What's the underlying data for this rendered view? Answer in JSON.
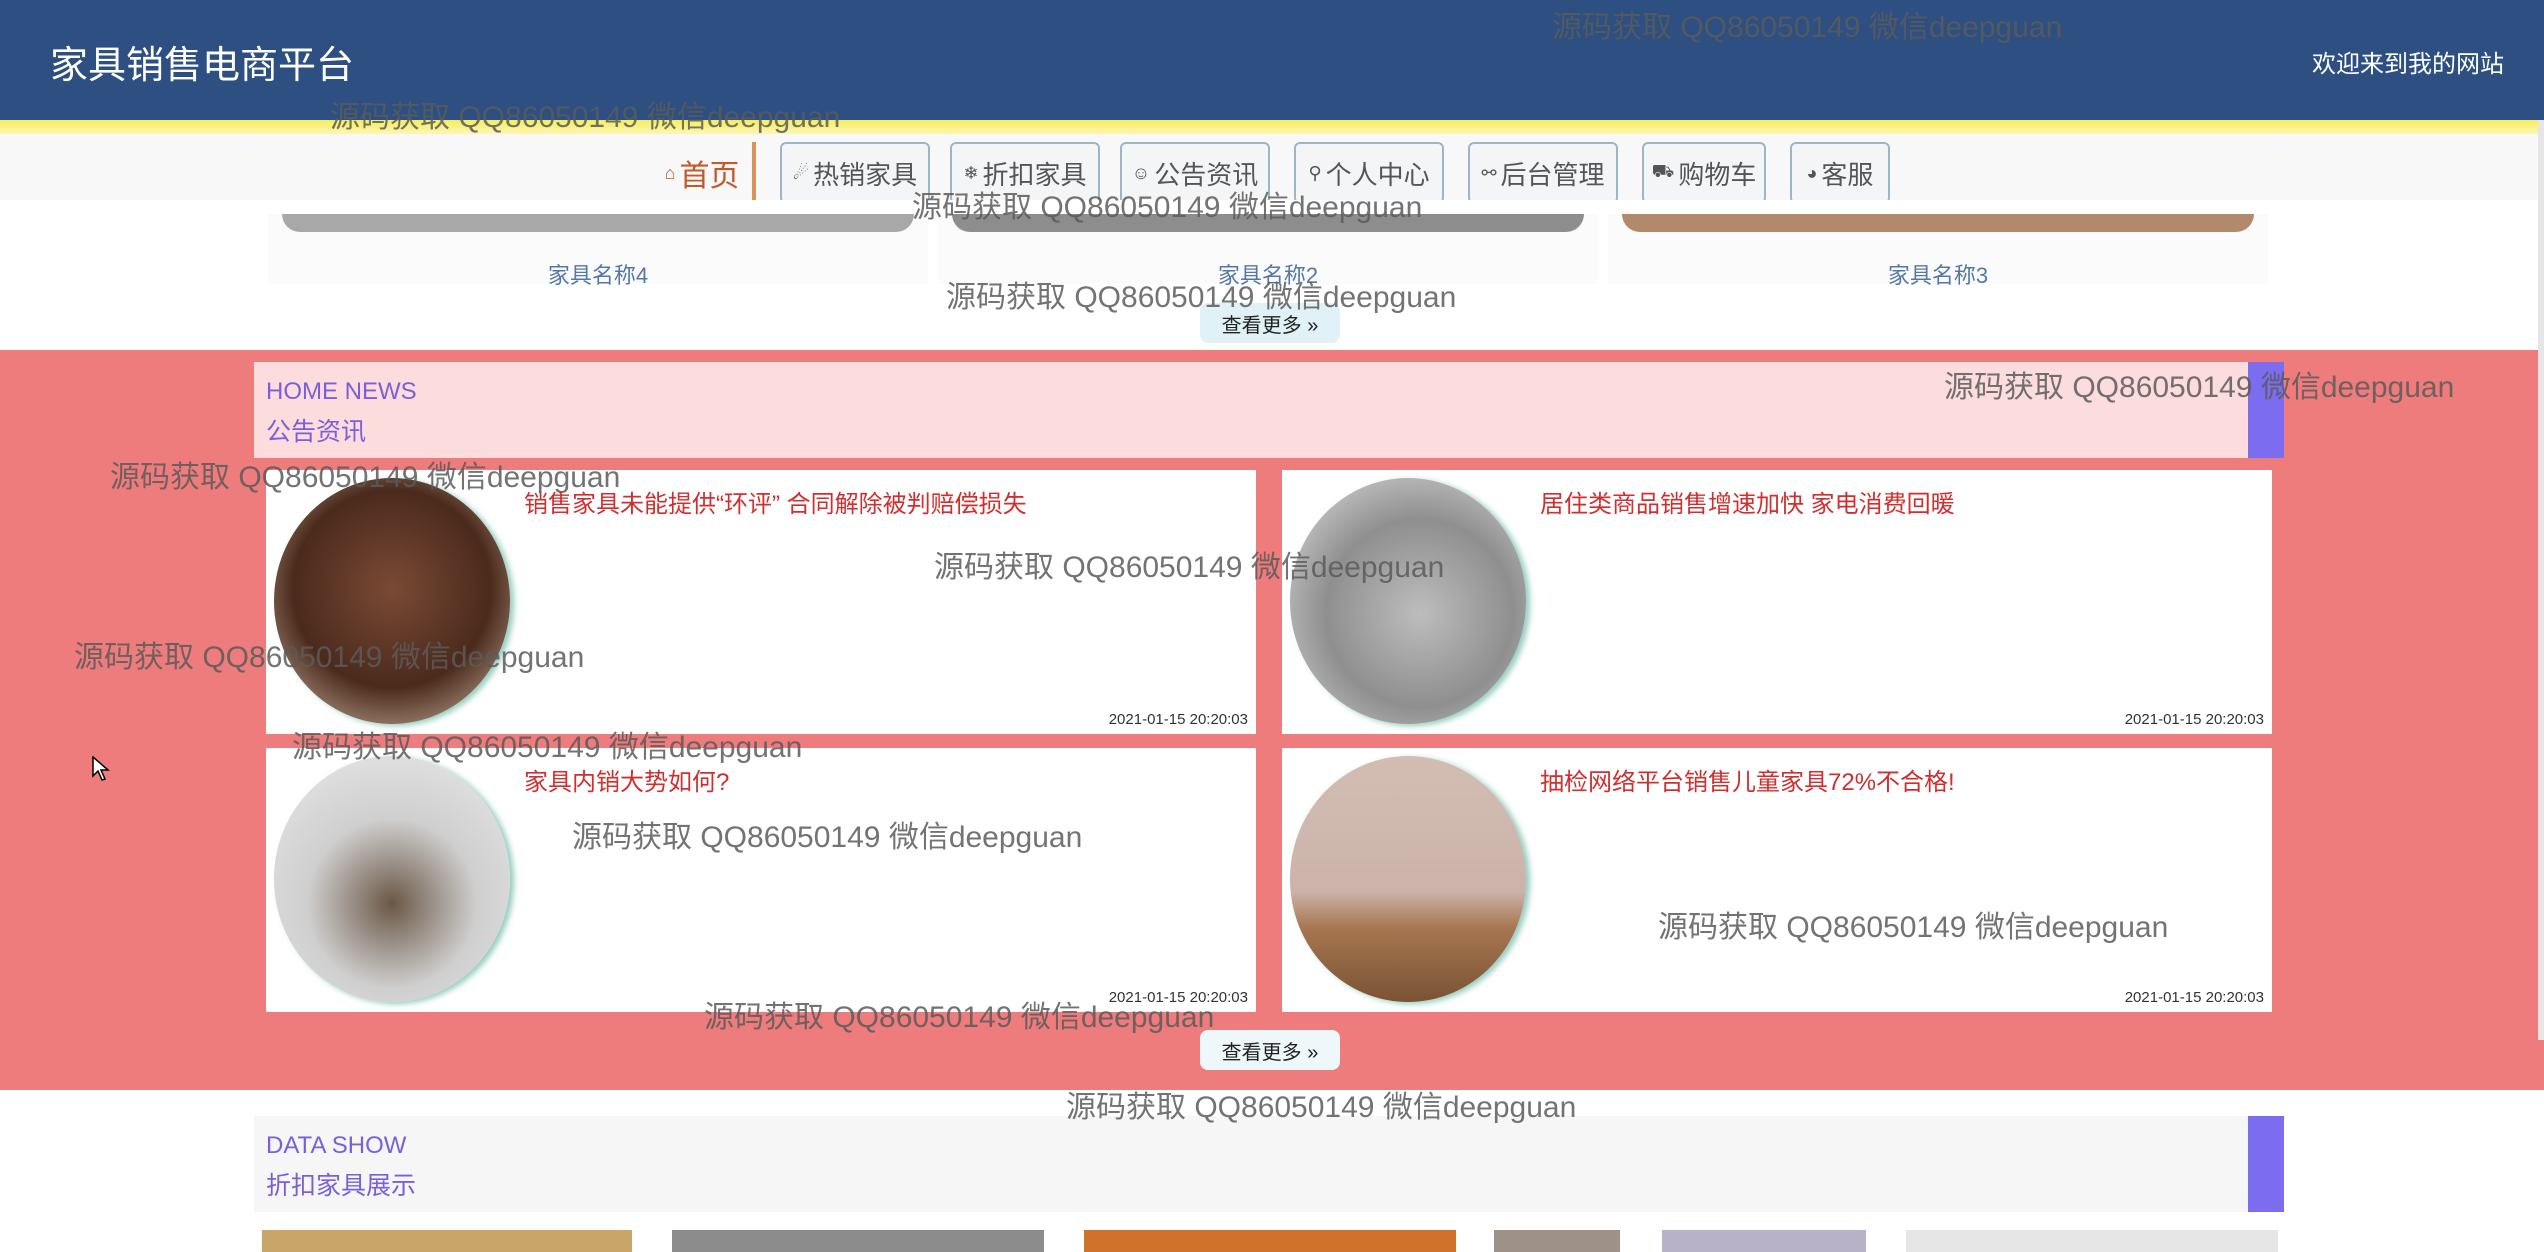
{
  "header": {
    "title": "家具销售电商平台",
    "welcome": "欢迎来到我的网站"
  },
  "nav": {
    "items": [
      {
        "label": "首页",
        "icon": "home-icon",
        "glyph": "⌂"
      },
      {
        "label": "热销家具",
        "icon": "fire-icon",
        "glyph": "☄"
      },
      {
        "label": "折扣家具",
        "icon": "snowflake-icon",
        "glyph": "❄"
      },
      {
        "label": "公告资讯",
        "icon": "bell-icon",
        "glyph": "☺"
      },
      {
        "label": "个人中心",
        "icon": "user-icon",
        "glyph": "⚲"
      },
      {
        "label": "后台管理",
        "icon": "link-icon",
        "glyph": "⚯"
      },
      {
        "label": "购物车",
        "icon": "cart-icon",
        "glyph": "⛟"
      },
      {
        "label": "客服",
        "icon": "chat-icon",
        "glyph": "◕"
      }
    ]
  },
  "products": {
    "names": [
      "家具名称4",
      "家具名称2",
      "家具名称3"
    ],
    "more": "查看更多 »"
  },
  "news": {
    "en": "HOME NEWS",
    "cn": "公告资讯",
    "items": [
      {
        "title": "销售家具未能提供“环评” 合同解除被判赔偿损失",
        "date": "2021-01-15 20:20:03"
      },
      {
        "title": "居住类商品销售增速加快 家电消费回暖",
        "date": "2021-01-15 20:20:03"
      },
      {
        "title": "家具内销大势如何?",
        "date": "2021-01-15 20:20:03"
      },
      {
        "title": "抽检网络平台销售儿童家具72%不合格!",
        "date": "2021-01-15 20:20:03"
      }
    ],
    "more": "查看更多 »"
  },
  "data_show": {
    "en": "DATA SHOW",
    "cn": "折扣家具展示"
  },
  "watermark": "源码获取 QQ86050149 微信deepguan",
  "colors": {
    "header": "#2d4f82",
    "news_bg": "#ef7c7d",
    "accent_purple": "#7c6cf0",
    "news_title": "#d02f2f"
  }
}
